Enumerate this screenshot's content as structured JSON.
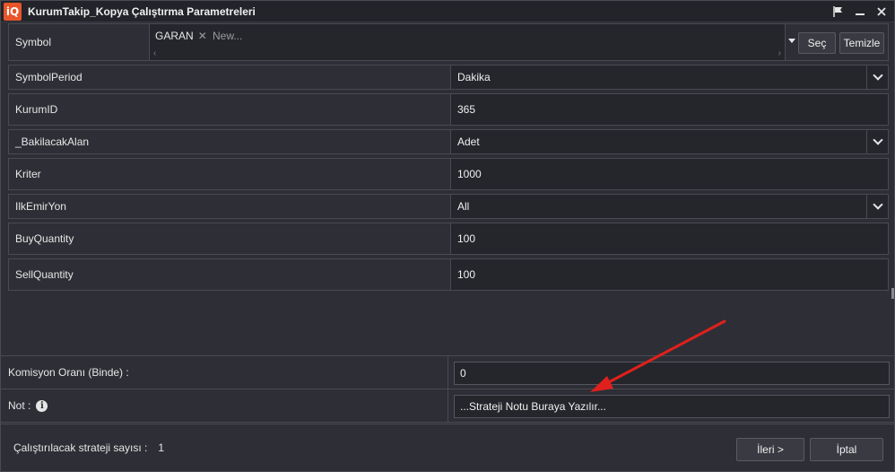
{
  "window": {
    "title": "KurumTakip_Kopya Çalıştırma Parametreleri",
    "logo": "iQ"
  },
  "symbol": {
    "label": "Symbol",
    "token": "GARAN",
    "placeholder": "New...",
    "select_label": "Seç",
    "clear_label": "Temizle"
  },
  "params": [
    {
      "label": "SymbolPeriod",
      "value": "Dakika",
      "type": "combo"
    },
    {
      "label": "KurumID",
      "value": "365",
      "type": "text"
    },
    {
      "label": "_BakilacakAlan",
      "value": "Adet",
      "type": "combo"
    },
    {
      "label": "Kriter",
      "value": "1000",
      "type": "text"
    },
    {
      "label": "IlkEmirYon",
      "value": "All",
      "type": "combo"
    },
    {
      "label": "BuyQuantity",
      "value": "100",
      "type": "text"
    },
    {
      "label": "SellQuantity",
      "value": "100",
      "type": "text"
    }
  ],
  "commission": {
    "label": "Komisyon Oranı (Binde) :",
    "value": "0"
  },
  "note": {
    "label": "Not :",
    "value": "...Strateji Notu Buraya Yazılır..."
  },
  "footer": {
    "count_label": "Çalıştırılacak strateji sayısı :",
    "count_value": "1",
    "next_label": "İleri >",
    "cancel_label": "İptal"
  },
  "colors": {
    "accent": "#e8552b",
    "annotation_arrow": "#e0201c"
  },
  "icons": [
    "flag-icon",
    "minimize-icon",
    "close-icon",
    "chevron-down-icon",
    "info-icon"
  ]
}
